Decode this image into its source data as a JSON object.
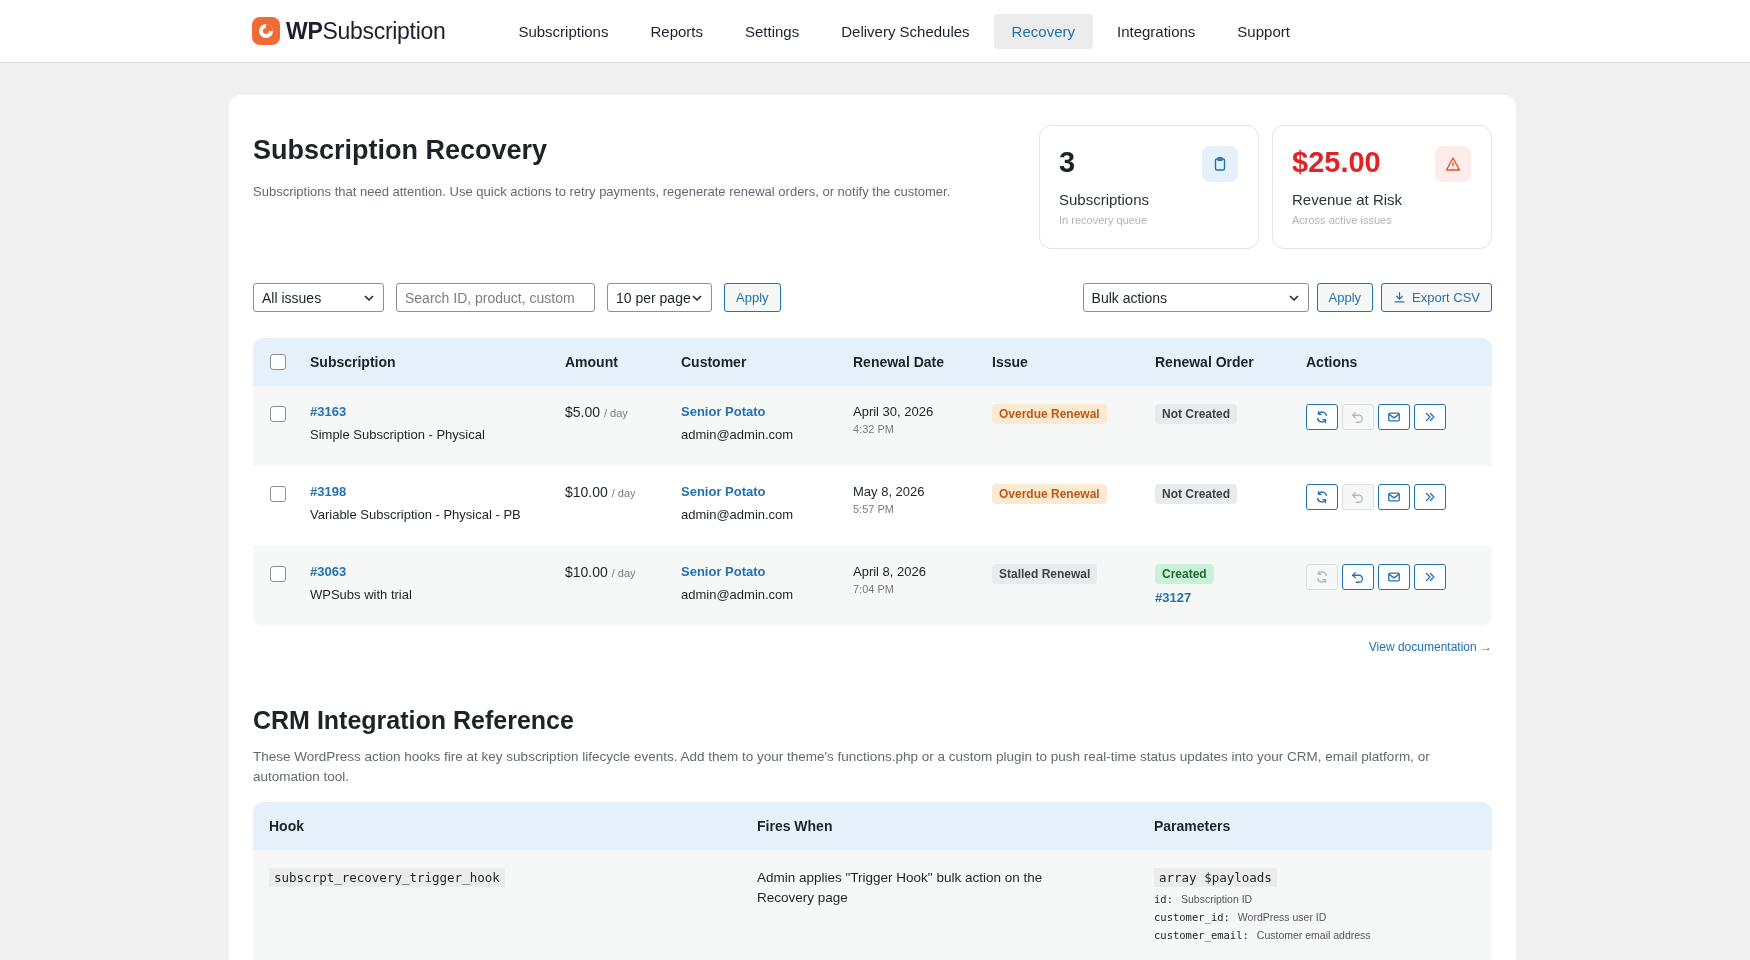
{
  "brand": {
    "bold": "WP",
    "rest": "Subscription"
  },
  "nav": [
    {
      "label": "Subscriptions",
      "selected": false
    },
    {
      "label": "Reports",
      "selected": false
    },
    {
      "label": "Settings",
      "selected": false
    },
    {
      "label": "Delivery Schedules",
      "selected": false
    },
    {
      "label": "Recovery",
      "selected": true
    },
    {
      "label": "Integrations",
      "selected": false
    },
    {
      "label": "Support",
      "selected": false
    }
  ],
  "page": {
    "title": "Subscription Recovery",
    "description": "Subscriptions that need attention. Use quick actions to retry payments, regenerate renewal orders, or notify the customer."
  },
  "stats": [
    {
      "kind": "count",
      "value": "3",
      "label": "Subscriptions",
      "caption": "In recovery queue"
    },
    {
      "kind": "risk",
      "value": "$25.00",
      "label": "Revenue at Risk",
      "caption": "Across active issues"
    }
  ],
  "filters": {
    "issue_select": "All issues",
    "search_placeholder": "Search ID, product, custom",
    "per_page_select": "10 per page",
    "apply": "Apply"
  },
  "bulk": {
    "select": "Bulk actions",
    "apply": "Apply",
    "export": "Export CSV"
  },
  "table": {
    "select_all_checked": false,
    "columns": [
      "Subscription",
      "Amount",
      "Customer",
      "Renewal Date",
      "Issue",
      "Renewal Order",
      "Actions"
    ],
    "rows": [
      {
        "checked": false,
        "id": "#3163",
        "product": "Simple Subscription - Physical",
        "amount": "$5.00",
        "period": "/ day",
        "customer": "Senior Potato",
        "email": "admin@admin.com",
        "date": "April 30, 2026",
        "time": "4:32 PM",
        "issue": {
          "kind": "overdue",
          "label": "Overdue Renewal"
        },
        "order": {
          "kind": "not_created",
          "label": "Not Created"
        },
        "actions": [
          {
            "kind": "retry",
            "disabled": false
          },
          {
            "kind": "regenerate",
            "disabled": true
          },
          {
            "kind": "email",
            "disabled": false
          },
          {
            "kind": "more",
            "disabled": false
          }
        ]
      },
      {
        "checked": false,
        "id": "#3198",
        "product": "Variable Subscription - Physical - PB",
        "amount": "$10.00",
        "period": "/ day",
        "customer": "Senior Potato",
        "email": "admin@admin.com",
        "date": "May 8, 2026",
        "time": "5:57 PM",
        "issue": {
          "kind": "overdue",
          "label": "Overdue Renewal"
        },
        "order": {
          "kind": "not_created",
          "label": "Not Created"
        },
        "actions": [
          {
            "kind": "retry",
            "disabled": false
          },
          {
            "kind": "regenerate",
            "disabled": true
          },
          {
            "kind": "email",
            "disabled": false
          },
          {
            "kind": "more",
            "disabled": false
          }
        ]
      },
      {
        "checked": false,
        "id": "#3063",
        "product": "WPSubs with trial",
        "amount": "$10.00",
        "period": "/ day",
        "customer": "Senior Potato",
        "email": "admin@admin.com",
        "date": "April 8, 2026",
        "time": "7:04 PM",
        "issue": {
          "kind": "stalled",
          "label": "Stalled Renewal"
        },
        "order": {
          "kind": "created",
          "label": "Created",
          "link": "#3127"
        },
        "actions": [
          {
            "kind": "retry",
            "disabled": true
          },
          {
            "kind": "regenerate",
            "disabled": false
          },
          {
            "kind": "email",
            "disabled": false
          },
          {
            "kind": "more",
            "disabled": false
          }
        ]
      }
    ]
  },
  "doc_link": "View documentation →",
  "crm": {
    "title": "CRM Integration Reference",
    "description": "These WordPress action hooks fire at key subscription lifecycle events. Add them to your theme's functions.php or a custom plugin to push real-time status updates into your CRM, email platform, or automation tool.",
    "columns": [
      "Hook",
      "Fires When",
      "Parameters"
    ],
    "rows": [
      {
        "hook": "subscrpt_recovery_trigger_hook",
        "fires": "Admin applies \"Trigger Hook\" bulk action on the Recovery page",
        "param_type": "array $payloads",
        "params": [
          {
            "key": "id:",
            "desc": "Subscription ID"
          },
          {
            "key": "customer_id:",
            "desc": "WordPress user ID"
          },
          {
            "key": "customer_email:",
            "desc": "Customer email address"
          }
        ]
      }
    ]
  }
}
